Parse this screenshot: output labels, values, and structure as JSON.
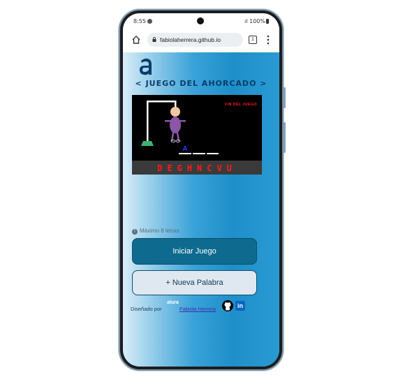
{
  "status_bar": {
    "time": "8:55",
    "battery": "100%"
  },
  "browser": {
    "url": "fabiolaherrera.github.io",
    "tab_count": "1"
  },
  "page": {
    "title": "< JUEGO DEL AHORCADO >",
    "game": {
      "end_message": "FIN DEL JUEGO",
      "revealed_letter": "A",
      "wrong_letters": "DEGHNCVU"
    },
    "hint": "Máximo 8 letras",
    "start_button": "Iniciar Juego",
    "new_word_button": "+ Nueva Palabra",
    "footer": {
      "designed_by": "Diseñado por",
      "alura": "alura",
      "author": "Fabiola Herrera",
      "linkedin": "in"
    }
  },
  "colors": {
    "accent": "#0e6b8f",
    "title": "#0a3d6b",
    "error_red": "#ff1a1a"
  }
}
